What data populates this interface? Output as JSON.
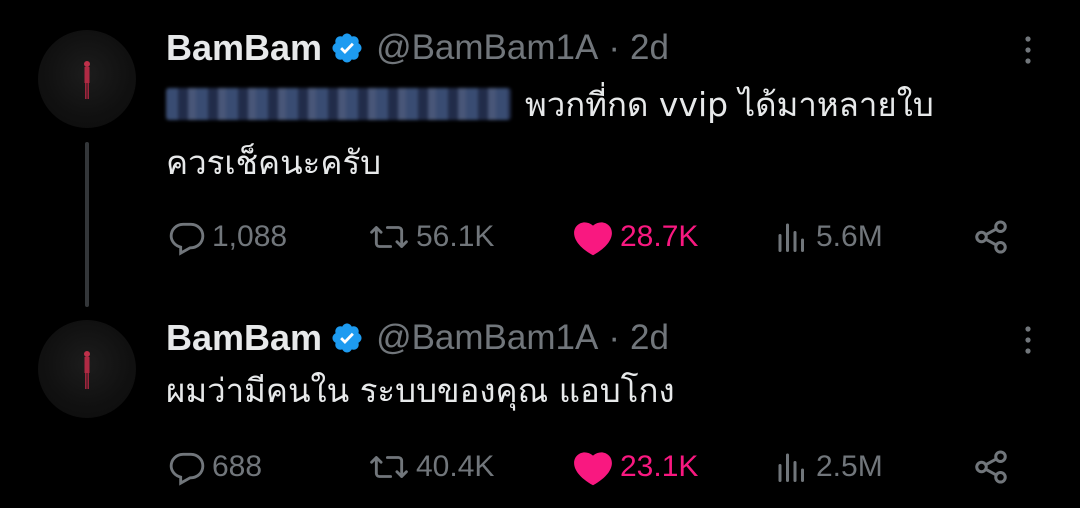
{
  "tweets": [
    {
      "author": {
        "display_name": "BamBam",
        "handle": "@BamBam1A",
        "verified": true
      },
      "time": "2d",
      "separator": "·",
      "text_line_1": "พวกที่กด vvip ได้มาหลายใบ",
      "text_line_2": "ควรเช็คนะครับ",
      "mention_blurred": true,
      "stats": {
        "replies": "1,088",
        "retweets": "56.1K",
        "likes": "28.7K",
        "views": "5.6M"
      },
      "liked": true,
      "has_thread_line": true
    },
    {
      "author": {
        "display_name": "BamBam",
        "handle": "@BamBam1A",
        "verified": true
      },
      "time": "2d",
      "separator": "·",
      "text_line_1": "ผมว่ามีคนใน ระบบของคุณ แอบโกง",
      "stats": {
        "replies": "688",
        "retweets": "40.4K",
        "likes": "23.1K",
        "views": "2.5M"
      },
      "liked": true,
      "has_thread_line": false
    }
  ],
  "icons": {
    "reply": "reply-icon",
    "retweet": "retweet-icon",
    "like": "heart-icon",
    "views": "views-icon",
    "share": "share-icon",
    "more": "more-vertical-icon",
    "verified": "verified-badge-icon"
  },
  "colors": {
    "background": "#000000",
    "text_primary": "#e7e9ea",
    "text_secondary": "#71767b",
    "like_active": "#f91880",
    "verified_blue": "#1d9bf0",
    "thread_line": "#333639"
  }
}
